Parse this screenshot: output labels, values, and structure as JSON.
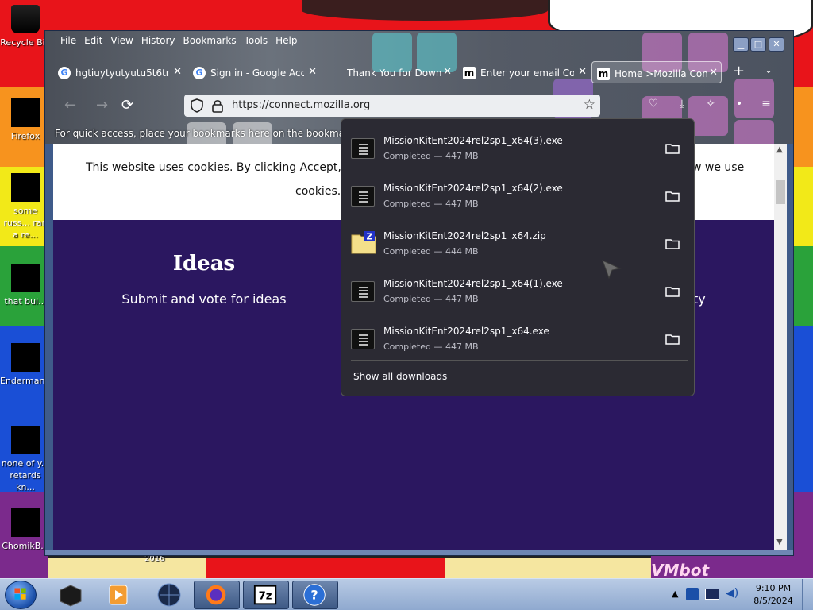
{
  "desktop": {
    "icons": [
      {
        "label": "Recycle Bin"
      },
      {
        "label": "Firefox"
      },
      {
        "label": "some russ... ran a re..."
      },
      {
        "label": "that bui..."
      },
      {
        "label": "Enderman..."
      },
      {
        "label": "none of y... retards kn..."
      },
      {
        "label": "ChomikB..."
      }
    ],
    "year_label": "2016",
    "watermark": "VMbot"
  },
  "browser": {
    "menu": [
      "File",
      "Edit",
      "View",
      "History",
      "Bookmarks",
      "Tools",
      "Help"
    ],
    "tabs": [
      {
        "label": "hgtiuytyutyutu5t6tr",
        "favicon": "G"
      },
      {
        "label": "Sign in - Google Acc",
        "favicon": "G"
      },
      {
        "label": "Thank You for Down",
        "favicon": ""
      },
      {
        "label": "Enter your email Con",
        "favicon": "m"
      },
      {
        "label": "Home >Mozilla Con",
        "favicon": "m",
        "active": true
      }
    ],
    "url": "https://connect.mozilla.org",
    "bookmarks_hint": "For quick access, place your bookmarks here on the bookmarks too"
  },
  "page": {
    "cookie_line1": "This website uses cookies. By clicking Accept, yo",
    "cookie_line1_end": "w we use",
    "cookie_line2": "cookies.",
    "ideas_title": "Ideas",
    "ideas_sub": "Submit and vote for ideas",
    "right_fragment": "ty"
  },
  "downloads": {
    "items": [
      {
        "name": "MissionKitEnt2024rel2sp1_x64(3).exe",
        "status": "Completed — 447 MB",
        "type": "exe"
      },
      {
        "name": "MissionKitEnt2024rel2sp1_x64(2).exe",
        "status": "Completed — 447 MB",
        "type": "exe"
      },
      {
        "name": "MissionKitEnt2024rel2sp1_x64.zip",
        "status": "Completed — 444 MB",
        "type": "zip"
      },
      {
        "name": "MissionKitEnt2024rel2sp1_x64(1).exe",
        "status": "Completed — 447 MB",
        "type": "exe"
      },
      {
        "name": "MissionKitEnt2024rel2sp1_x64.exe",
        "status": "Completed — 447 MB",
        "type": "exe"
      }
    ],
    "show_all": "Show all downloads"
  },
  "taskbar": {
    "time": "9:10 PM",
    "date": "8/5/2024",
    "pinned": [
      "start-menu",
      "virtualbox",
      "media-player",
      "globe",
      "firefox",
      "7zip",
      "help"
    ]
  }
}
